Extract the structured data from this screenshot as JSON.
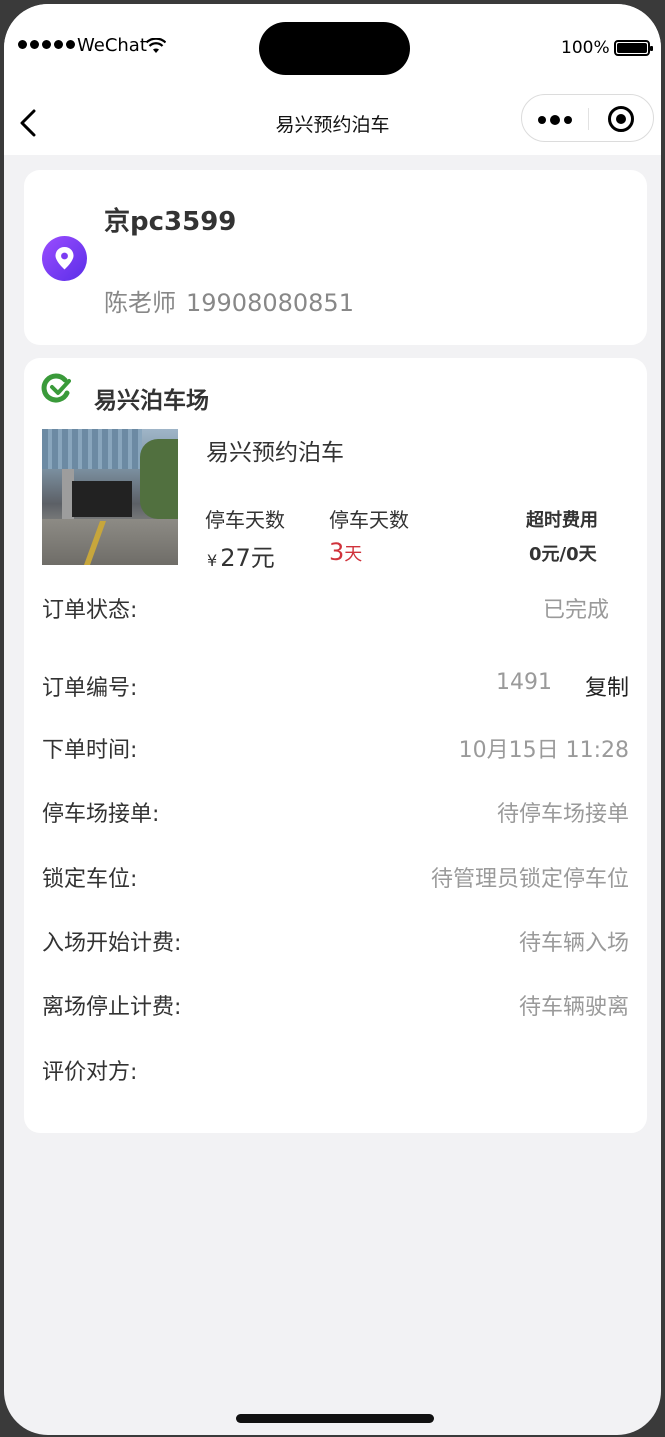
{
  "status_bar": {
    "carrier": "WeChat",
    "battery": "100%"
  },
  "nav": {
    "title": "易兴预约泊车"
  },
  "vehicle": {
    "plate": "京pc3599",
    "contact_name": "陈老师",
    "contact_phone": "19908080851"
  },
  "order": {
    "lot_name": "易兴泊车场",
    "service_name": "易兴预约泊车",
    "stats": {
      "fee_label": "停车天数",
      "fee_currency": "¥",
      "fee_value": "27元",
      "days_label": "停车天数",
      "days_value": "3",
      "days_unit": "天",
      "overtime_label": "超时费用",
      "overtime_value": "0元/0天"
    },
    "rows": {
      "status_label": "订单状态:",
      "status_value": "已完成",
      "number_label": "订单编号:",
      "number_value": "1491",
      "copy_label": "复制",
      "time_label": "下单时间:",
      "time_value": "10月15日 11:28",
      "accept_label": "停车场接单:",
      "accept_value": "待停车场接单",
      "lock_label": "锁定车位:",
      "lock_value": "待管理员锁定停车位",
      "entry_label": "入场开始计费:",
      "entry_value": "待车辆入场",
      "exit_label": "离场停止计费:",
      "exit_value": "待车辆驶离",
      "review_label": "评价对方:"
    }
  },
  "colors": {
    "accent_purple": "#7b3cf2",
    "highlight_red": "#d0323b",
    "logo_green": "#3a9a3a",
    "muted_text": "#9a9a9a"
  },
  "icons": {
    "back": "chevron-left-icon",
    "more": "more-dots-icon",
    "close_target": "target-icon",
    "location": "location-pin-icon",
    "lot_logo": "lot-logo-icon"
  }
}
